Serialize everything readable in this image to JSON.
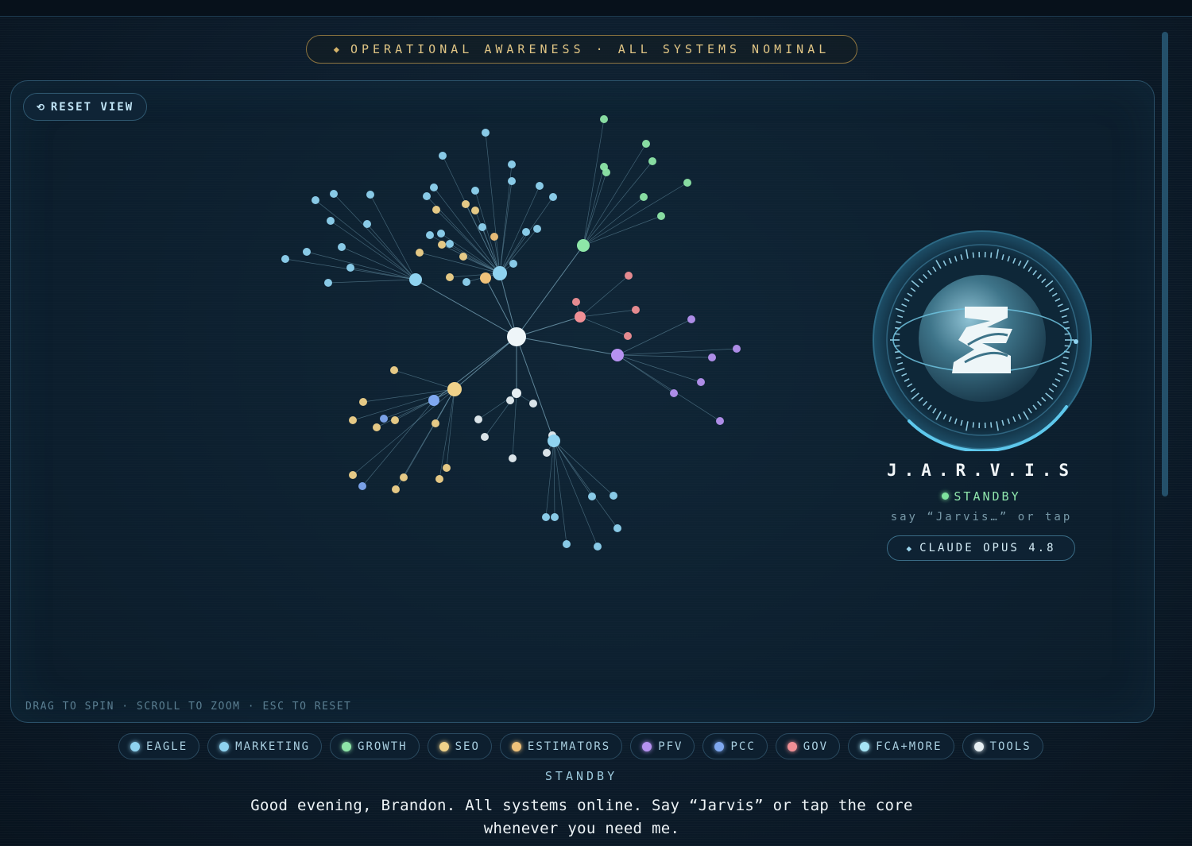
{
  "banner": {
    "icon": "diamond-icon",
    "text": "OPERATIONAL AWARENESS · ALL SYSTEMS NOMINAL"
  },
  "toolbar": {
    "reset_icon": "reset-icon",
    "reset_label": "RESET VIEW"
  },
  "hint": "DRAG TO SPIN · SCROLL TO ZOOM · ESC TO RESET",
  "assistant": {
    "name": "J.A.R.V.I.S",
    "status": "STANDBY",
    "status_color": "#7ee29d",
    "say_hint": "say “Jarvis…” or tap",
    "model_icon": "diamond-icon",
    "model": "CLAUDE OPUS 4.8"
  },
  "legend": [
    {
      "label": "EAGLE",
      "color": "#8fd3f0"
    },
    {
      "label": "MARKETING",
      "color": "#8fd3f0"
    },
    {
      "label": "GROWTH",
      "color": "#8ee6a8"
    },
    {
      "label": "SEO",
      "color": "#f0d28a"
    },
    {
      "label": "ESTIMATORS",
      "color": "#f0c27a"
    },
    {
      "label": "PFV",
      "color": "#b692f0"
    },
    {
      "label": "PCC",
      "color": "#7fa8f0"
    },
    {
      "label": "GOV",
      "color": "#f08f95"
    },
    {
      "label": "FCA+MORE",
      "color": "#a6e4f5"
    },
    {
      "label": "TOOLS",
      "color": "#e6eef2"
    }
  ],
  "bottom_status": "STANDBY",
  "message": "Good evening, Brandon. All systems online. Say “Jarvis” or tap the core whenever you need me."
}
